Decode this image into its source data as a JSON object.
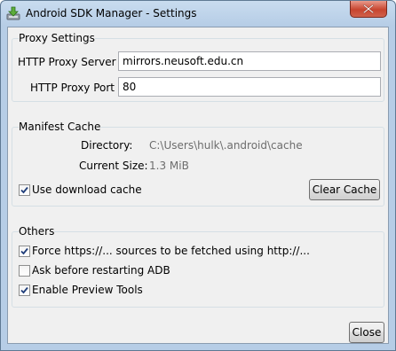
{
  "window": {
    "title": "Android SDK Manager - Settings"
  },
  "proxy": {
    "group_title": "Proxy Settings",
    "server_label": "HTTP Proxy Server",
    "server_value": "mirrors.neusoft.edu.cn",
    "port_label": "HTTP Proxy Port",
    "port_value": "80"
  },
  "manifest": {
    "group_title": "Manifest Cache",
    "directory_label": "Directory:",
    "directory_value": "C:\\Users\\hulk\\.android\\cache",
    "size_label": "Current Size:",
    "size_value": "1.3 MiB",
    "use_cache_label": "Use download cache",
    "use_cache_checked": true,
    "clear_button": "Clear Cache"
  },
  "others": {
    "group_title": "Others",
    "options": [
      {
        "label": "Force https://... sources to be fetched using http://...",
        "checked": true
      },
      {
        "label": "Ask before restarting ADB",
        "checked": false
      },
      {
        "label": "Enable Preview Tools",
        "checked": true
      }
    ]
  },
  "footer": {
    "close_button": "Close"
  },
  "icons": {
    "app": "download-arrow-icon",
    "window_close": "close-icon"
  },
  "colors": {
    "title_bar": "#b6cde6",
    "close_button": "#c7452f",
    "dialog_bg": "#f0f0f0"
  }
}
